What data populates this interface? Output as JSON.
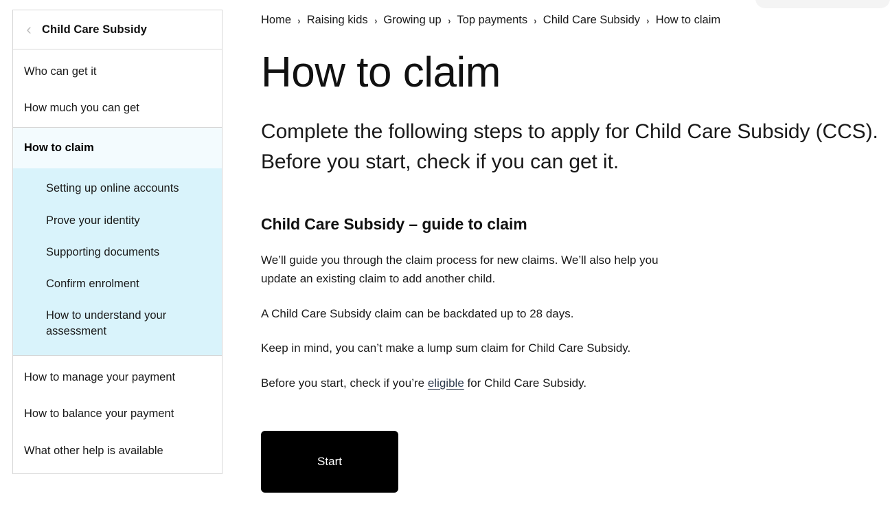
{
  "theme": {
    "accent_highlight": "#d9f3fb",
    "accent_active": "#f3fbfe",
    "border": "#d7d7d7",
    "link": "#2e3b4e",
    "button_bg": "#000000",
    "button_text": "#ffffff"
  },
  "sidebar": {
    "back_icon": "chevron-left-icon",
    "back_glyph": "‹",
    "title": "Child Care Subsidy",
    "items_top": [
      {
        "label": "Who can get it"
      },
      {
        "label": "How much you can get"
      }
    ],
    "active_item": {
      "label": "How to claim"
    },
    "sub_items": [
      {
        "label": "Setting up online accounts"
      },
      {
        "label": "Prove your identity"
      },
      {
        "label": "Supporting documents"
      },
      {
        "label": "Confirm enrolment"
      },
      {
        "label": "How to understand your assessment"
      }
    ],
    "items_bottom": [
      {
        "label": "How to manage your payment"
      },
      {
        "label": "How to balance your payment"
      },
      {
        "label": "What other help is available"
      }
    ]
  },
  "breadcrumb": {
    "separator": "›",
    "items": [
      {
        "label": "Home"
      },
      {
        "label": "Raising kids"
      },
      {
        "label": "Growing up"
      },
      {
        "label": "Top payments"
      },
      {
        "label": "Child Care Subsidy"
      },
      {
        "label": "How to claim"
      }
    ]
  },
  "main": {
    "title": "How to claim",
    "intro": "Complete the following steps to apply for Child Care Subsidy (CCS). Before you start, check if you can get it.",
    "section_title": "Child Care Subsidy – guide to claim",
    "paragraphs": [
      "We’ll guide you through the claim process for new claims. We’ll also help you update an existing claim to add another child.",
      "A Child Care Subsidy claim can be backdated up to 28 days.",
      "Keep in mind, you can’t make a lump sum claim for Child Care Subsidy."
    ],
    "eligible_line": {
      "before": "Before you start, check if you’re ",
      "link": "eligible",
      "after": " for Child Care Subsidy."
    },
    "start_button": "Start"
  }
}
